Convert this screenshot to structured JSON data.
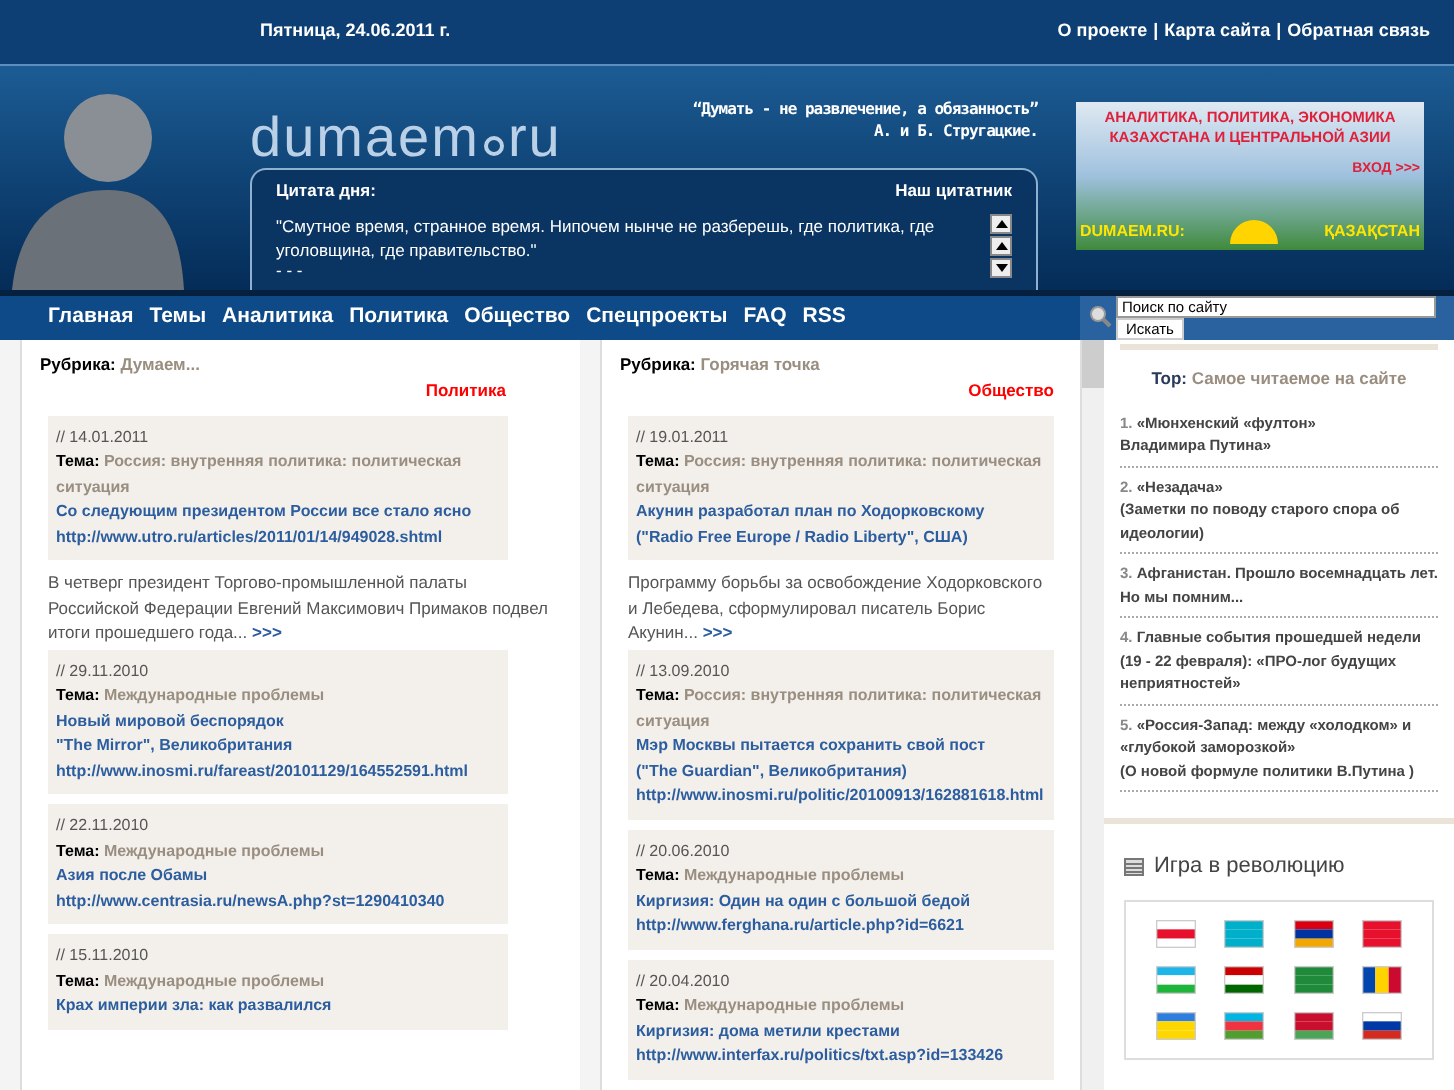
{
  "top_bar": {
    "date": "Пятница, 24.06.2011 г.",
    "links": [
      "О проекте",
      "Карта сайта",
      "Обратная связь"
    ],
    "separator": "|"
  },
  "header": {
    "logo_left": "dumaem",
    "logo_right": "ru",
    "motto": "“Думать - не развлечение, а обязанность”",
    "motto_author": "А. и Б. Стругацкие.",
    "quote_box": {
      "title": "Цитата дня:",
      "link": "Наш цитатник",
      "text": "\"Смутное время, странное время. Нипочем нынче не разберешь, где политика, где уголовщина, где правительство.\"",
      "more": "- - -"
    },
    "banner": {
      "headline": "АНАЛИТИКА, ПОЛИТИКА, ЭКОНОМИКА КАЗАХСТАНА И ЦЕНТРАЛЬНОЙ АЗИИ",
      "enter": "ВХОД >>>",
      "site": "DUMAEM.RU:",
      "country": "ҚАЗАҚСТАН"
    }
  },
  "nav": [
    "Главная",
    "Темы",
    "Аналитика",
    "Политика",
    "Общество",
    "Спецпроекты",
    "FAQ",
    "RSS"
  ],
  "search": {
    "value": "Поиск по сайту",
    "button": "Искать"
  },
  "columns": [
    {
      "rubric_label": "Рубрика:",
      "rubric": "Думаем...",
      "category": "Политика",
      "entries": [
        {
          "kind": "card",
          "date": "// 14.01.2011",
          "theme_label": "Тема:",
          "theme": "Россия: внутренняя политика: политическая ситуация",
          "title_lines": [
            "Со следующим президентом России все стало ясно"
          ],
          "url": "http://www.utro.ru/articles/2011/01/14/949028.shtml"
        },
        {
          "kind": "excerpt",
          "text": "В четверг президент Торгово-промышленной палаты Российской Федерации Евгений Максимович Примаков подвел итоги прошедшего года...",
          "more": ">>>"
        },
        {
          "kind": "card",
          "date": "// 29.11.2010",
          "theme_label": "Тема:",
          "theme": "Международные проблемы",
          "title_lines": [
            "Новый мировой беспорядок",
            "\"The Mirror\", Великобритания"
          ],
          "url": "http://www.inosmi.ru/fareast/20101129/164552591.html"
        },
        {
          "kind": "card",
          "date": "// 22.11.2010",
          "theme_label": "Тема:",
          "theme": "Международные проблемы",
          "title_lines": [
            "Азия после Обамы"
          ],
          "url": "http://www.centrasia.ru/newsA.php?st=1290410340"
        },
        {
          "kind": "card",
          "date": "// 15.11.2010",
          "theme_label": "Тема:",
          "theme": "Международные проблемы",
          "title_lines": [
            "Крах империи зла: как развалился"
          ]
        }
      ]
    },
    {
      "rubric_label": "Рубрика:",
      "rubric": "Горячая точка",
      "category": "Общество",
      "entries": [
        {
          "kind": "card",
          "date": "// 19.01.2011",
          "theme_label": "Тема:",
          "theme": "Россия: внутренняя политика: политическая ситуация",
          "title_lines": [
            "Акунин разработал план по Ходорковскому",
            "(\"Radio Free Europe / Radio Liberty\", США)"
          ]
        },
        {
          "kind": "excerpt",
          "text": "Программу борьбы за освобождение Ходорковского и Лебедева, сформулировал писатель Борис Акунин...",
          "more": ">>>"
        },
        {
          "kind": "card",
          "date": "// 13.09.2010",
          "theme_label": "Тема:",
          "theme": "Россия: внутренняя политика: политическая ситуация",
          "title_lines": [
            "Мэр Москвы пытается сохранить свой пост",
            "(\"The Guardian\", Великобритания)"
          ],
          "url": "http://www.inosmi.ru/politic/20100913/162881618.html"
        },
        {
          "kind": "card",
          "date": "// 20.06.2010",
          "theme_label": "Тема:",
          "theme": "Международные проблемы",
          "title_lines": [
            "Киргизия: Один на один с большой бедой"
          ],
          "url": "http://www.ferghana.ru/article.php?id=6621"
        },
        {
          "kind": "card",
          "date": "// 20.04.2010",
          "theme_label": "Тема:",
          "theme": "Международные проблемы",
          "title_lines": [
            "Киргизия: дома метили крестами"
          ],
          "url": "http://www.interfax.ru/politics/txt.asp?id=133426"
        }
      ]
    }
  ],
  "top_list": {
    "label": "Top:",
    "title": "Самое читаемое на сайте",
    "items": [
      {
        "number": "1.",
        "lines": [
          "«Мюнхенский «фултон»",
          "Владимира Путина»"
        ]
      },
      {
        "number": "2.",
        "lines": [
          "«Незадача»",
          "(Заметки по поводу старого спора об идеологии)"
        ]
      },
      {
        "number": "3.",
        "lines": [
          "Афганистан. Прошло восемнадцать лет. Но мы помним..."
        ]
      },
      {
        "number": "4.",
        "lines": [
          "Главные события прошедшей недели (19 - 22 февраля): «ПРО-лог будущих неприятностей»"
        ]
      },
      {
        "number": "5.",
        "lines": [
          "«Россия-Запад: между «холодком» и «глубокой заморозкой»",
          "(О новой формуле политики В.Путина )"
        ]
      }
    ]
  },
  "game": {
    "title": "Игра в революцию"
  }
}
